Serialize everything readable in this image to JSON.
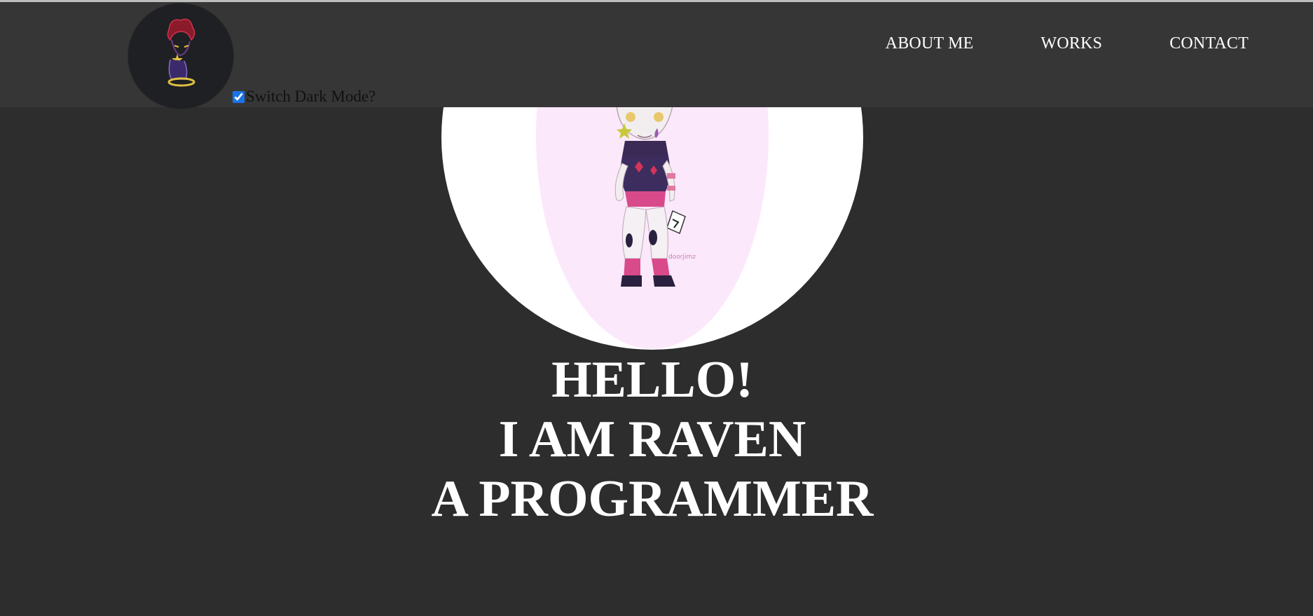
{
  "header": {
    "dark_mode_label": "Switch Dark Mode?",
    "dark_mode_checked": true,
    "logo_icon": "avatar-character-icon",
    "nav": [
      {
        "label": "ABOUT ME"
      },
      {
        "label": "WORKS"
      },
      {
        "label": "CONTACT"
      }
    ]
  },
  "hero": {
    "image_icon": "chibi-character-illustration",
    "lines": [
      "HELLO!",
      "I AM RAVEN",
      "A PROGRAMMER"
    ]
  },
  "colors": {
    "background": "#2d2d2d",
    "navbar": "#363636",
    "text": "#ffffff",
    "hero_circle": "#ffffff",
    "hero_inner": "#fce8fb"
  }
}
